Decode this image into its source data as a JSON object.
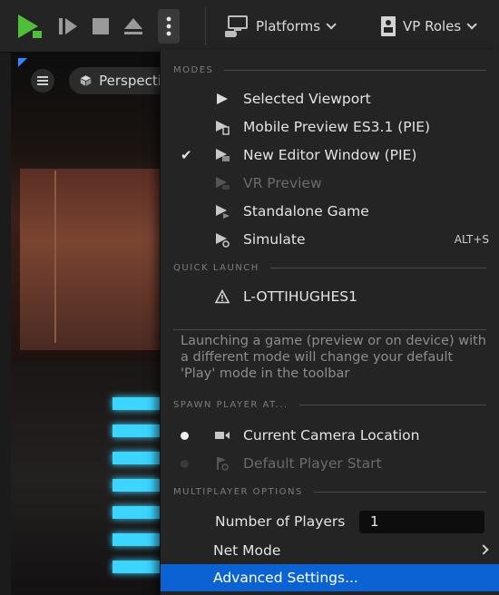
{
  "toolbar": {
    "platforms_label": "Platforms",
    "vp_roles_label": "VP Roles",
    "colors": {
      "play_green": "#4fbf3a",
      "button_gray": "#a8a8a8"
    }
  },
  "viewport": {
    "perspective_label": "Perspective"
  },
  "menu": {
    "modes_header": "MODES",
    "modes": [
      {
        "label": "Selected Viewport",
        "icon": "play-icon",
        "checked": false,
        "enabled": true
      },
      {
        "label": "Mobile Preview ES3.1 (PIE)",
        "icon": "mobile-preview-icon",
        "checked": false,
        "enabled": true
      },
      {
        "label": "New Editor Window (PIE)",
        "icon": "editor-window-icon",
        "checked": true,
        "enabled": true,
        "check_mark": "✔"
      },
      {
        "label": "VR Preview",
        "icon": "vr-preview-icon",
        "checked": false,
        "enabled": false
      },
      {
        "label": "Standalone Game",
        "icon": "standalone-game-icon",
        "checked": false,
        "enabled": true
      },
      {
        "label": "Simulate",
        "icon": "simulate-icon",
        "checked": false,
        "enabled": true,
        "shortcut": "ALT+S"
      }
    ],
    "quick_launch_header": "QUICK LAUNCH",
    "quick_launch_device": "L-OTTIHUGHES1",
    "hint_text": "Launching a game (preview or on device) with a different mode will change your default 'Play' mode in the toolbar",
    "spawn_header": "SPAWN PLAYER AT...",
    "spawn_options": [
      {
        "label": "Current Camera Location",
        "selected": true,
        "enabled": true
      },
      {
        "label": "Default Player Start",
        "selected": false,
        "enabled": false
      }
    ],
    "multiplayer_header": "MULTIPLAYER OPTIONS",
    "number_of_players_label": "Number of Players",
    "number_of_players_value": "1",
    "net_mode_label": "Net Mode",
    "advanced_settings_label": "Advanced Settings...",
    "highlight_color": "#0b63d3"
  }
}
